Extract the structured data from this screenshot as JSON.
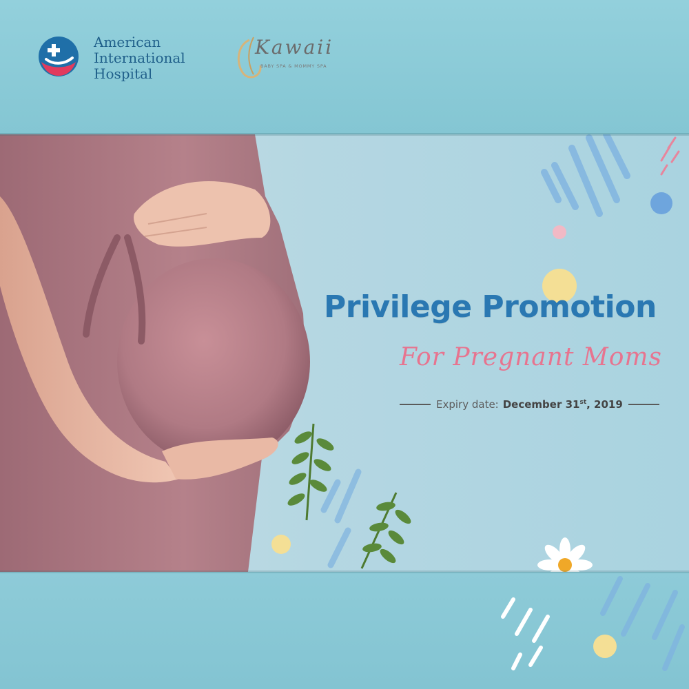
{
  "logo_hospital": {
    "line1": "American",
    "line2": "International",
    "line3": "Hospital",
    "icon": "cross-hands-icon"
  },
  "logo_kawaii": {
    "name": "Kawaii",
    "tagline": "BABY SPA & MOMMY SPA"
  },
  "headline": "Privilege Promotion",
  "subheadline": "For Pregnant Moms",
  "expiry": {
    "label": "Expiry date:",
    "date_prefix": "December 31",
    "date_suffix": "st",
    "date_year": ", 2019"
  },
  "colors": {
    "headline": "#2a78b2",
    "subheadline": "#e7748f",
    "background": "#8cc9d6",
    "dress": "#b27d86"
  }
}
